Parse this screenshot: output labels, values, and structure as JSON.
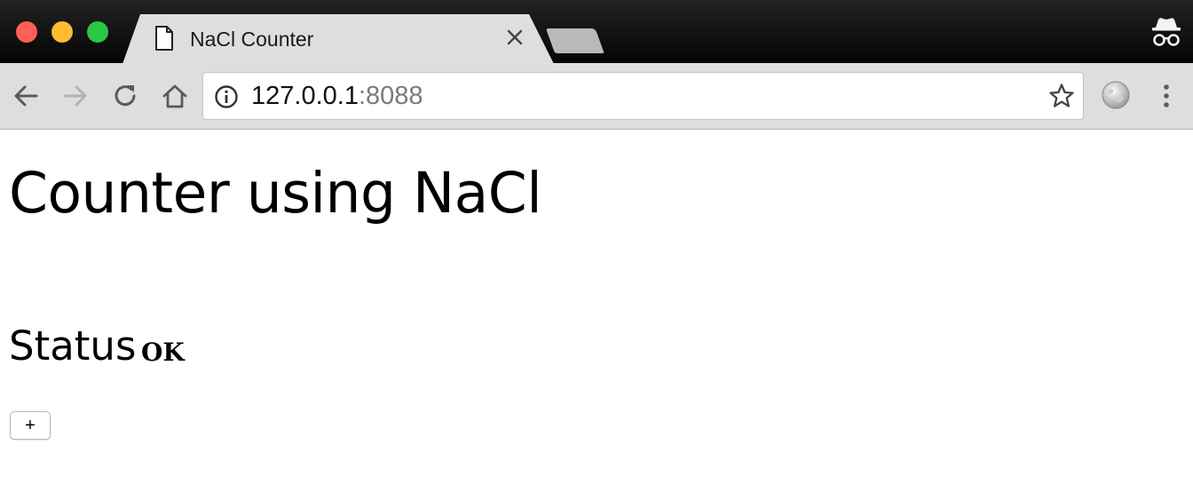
{
  "browser": {
    "tab": {
      "title": "NaCl Counter"
    },
    "address_bar": {
      "host": "127.0.0.1",
      "port": ":8088"
    },
    "icons": {
      "close": "close-icon",
      "page": "page-icon",
      "back": "back-arrow-icon",
      "forward": "forward-arrow-icon",
      "reload": "reload-icon",
      "home": "home-icon",
      "info": "info-icon",
      "bookmark": "star-icon",
      "extension": "globe-icon",
      "menu": "kebab-menu-icon",
      "incognito": "incognito-icon"
    },
    "colors": {
      "titlebar": "#111111",
      "tab": "#dedede",
      "toolbar": "#dedede",
      "traffic_red": "#fe5f57",
      "traffic_yellow": "#febc2e",
      "traffic_green": "#28c840"
    }
  },
  "page": {
    "title": "Counter using NaCl",
    "status_label": "Status",
    "status_value": "OK",
    "increment_label": "+"
  }
}
